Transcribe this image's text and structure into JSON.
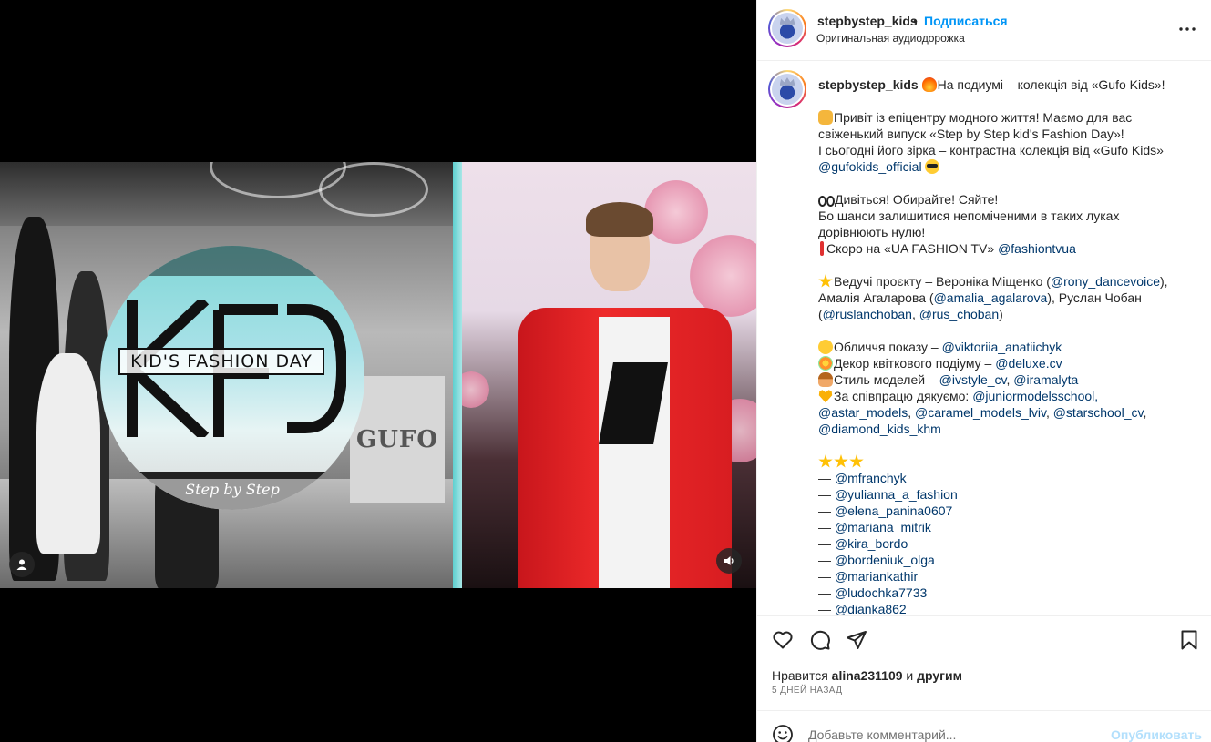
{
  "media": {
    "logo_title": "KID'S FASHION DAY",
    "logo_subtitle": "Step by Step",
    "sign_text": "GUFO"
  },
  "header": {
    "username": "stepbystep_kids",
    "separator": "•",
    "follow_label": "Подписаться",
    "audio_label": "Оригинальная аудиодорожка",
    "more_icon": "more-horizontal-icon"
  },
  "caption": {
    "username": "stepbystep_kids",
    "lines": [
      "На подиумі – колекція від «Gufo Kids»!",
      "",
      "Привіт із епіцентру модного життя! Маємо для вас",
      "свіженький випуск «Step by Step kid's Fashion Day»!",
      "І сьогодні його зірка – контрастна колекція від «Gufo Kids»",
      "@gufokids_official",
      "",
      "Дивіться! Обирайте! Сяйте!",
      "Бо шанси залишитися непоміченими в таких луках",
      "дорівнюють нулю!",
      "Скоро на «UA FASHION TV»",
      "@fashiontvua",
      "",
      "Ведучі проєкту – Вероніка Міщенко (",
      "@rony_dancevoice",
      "),",
      "Амалія Агаларова (",
      "@amalia_agalarova",
      "), Руслан Чобан",
      "(",
      "@ruslanchoban",
      ", ",
      "@rus_choban",
      ")",
      "",
      "Обличчя показу – ",
      "@viktoriia_anatiichyk",
      "Декор квіткового подіуму – ",
      "@deluxe.cv",
      "Стиль моделей – ",
      "@ivstyle_cv",
      ", ",
      "@iramalyta",
      "За співпрацю дякуємо: ",
      "@juniormodelsschool,",
      "@astar_models",
      ", ",
      "@caramel_models_lviv",
      ", ",
      "@starschool_cv",
      ",",
      "@diamond_kids_khm",
      "",
      "— ",
      "@mfranchyk",
      "@yulianna_a_fashion",
      "@elena_panina0607",
      "@mariana_mitrik",
      "@kira_bordo",
      "@bordeniuk_olga",
      "@mariankathir",
      "@ludochka7733",
      "@dianka862"
    ]
  },
  "actions": {
    "like_icon": "heart-icon",
    "comment_icon": "comment-icon",
    "share_icon": "share-icon",
    "save_icon": "bookmark-icon",
    "likes_prefix": "Нравится",
    "likes_user": "alina231109",
    "likes_suffix": "и",
    "likes_others": "другим",
    "date": "5 ДНЕЙ НАЗАД"
  },
  "comment": {
    "placeholder": "Добавьте комментарий...",
    "publish_label": "Опубликовать"
  },
  "colors": {
    "link": "#0095f6",
    "mention": "#00376b",
    "publish_disabled": "#b2dffc"
  }
}
